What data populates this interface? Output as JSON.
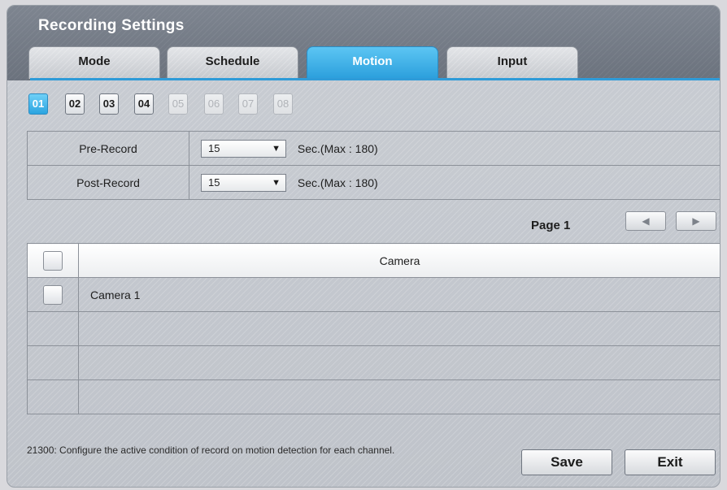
{
  "window": {
    "title": "Recording Settings"
  },
  "tabs": [
    {
      "label": "Mode"
    },
    {
      "label": "Schedule"
    },
    {
      "label": "Motion"
    },
    {
      "label": "Input"
    }
  ],
  "active_tab": "Motion",
  "channels": [
    "01",
    "02",
    "03",
    "04",
    "05",
    "06",
    "07",
    "08"
  ],
  "settings": {
    "pre_record": {
      "label": "Pre-Record",
      "value": "15",
      "unit": "Sec.(Max : 180)"
    },
    "post_record": {
      "label": "Post-Record",
      "value": "15",
      "unit": "Sec.(Max : 180)"
    }
  },
  "pager": {
    "label": "Page 1"
  },
  "camera_table": {
    "header": "Camera",
    "rows": [
      "Camera 1",
      "",
      "",
      ""
    ]
  },
  "help_text": "21300: Configure the active condition of record on motion detection for each channel.",
  "buttons": {
    "save": "Save",
    "exit": "Exit"
  },
  "colors": {
    "accent": "#2b9fdc",
    "title_bar": "#737a85"
  }
}
